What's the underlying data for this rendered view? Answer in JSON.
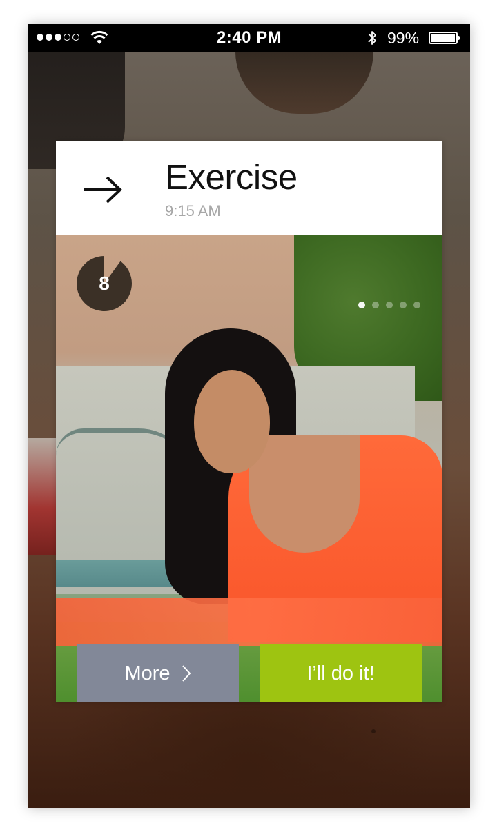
{
  "status_bar": {
    "time": "2:40 PM",
    "battery_percent": "99%",
    "signal_bars_filled": 3,
    "signal_bars_total": 5
  },
  "card": {
    "title": "Exercise",
    "time": "9:15 AM",
    "icon": "arrow-right-icon",
    "countdown": "8",
    "countdown_progress": 0.9,
    "page_indicator": {
      "count": 5,
      "active_index": 0
    },
    "buttons": {
      "more_label": "More",
      "do_label": "I’ll do it!"
    }
  },
  "colors": {
    "more_button": "#828898",
    "do_button": "#9ec411",
    "countdown_dial": "#3b3026",
    "status_bar": "#000000"
  }
}
